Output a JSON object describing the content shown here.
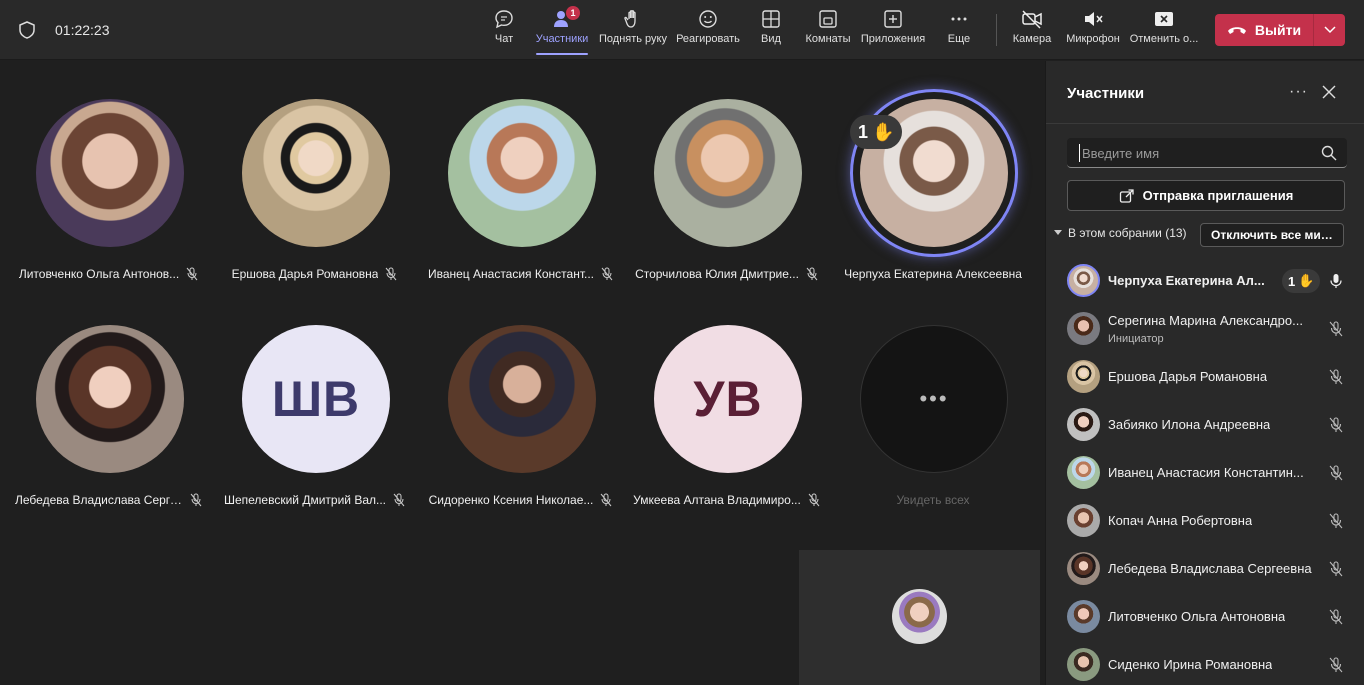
{
  "toolbar": {
    "timer": "01:22:23",
    "chat": "Чат",
    "participants": "Участники",
    "participants_badge": "1",
    "raise_hand": "Поднять руку",
    "react": "Реагировать",
    "view": "Вид",
    "rooms": "Комнаты",
    "apps": "Приложения",
    "more": "Еще",
    "camera": "Камера",
    "mic": "Микрофон",
    "share": "Отменить о...",
    "leave": "Выйти"
  },
  "stage": {
    "tiles": [
      {
        "name": "Литовченко Ольга Антонов..."
      },
      {
        "name": "Ершова Дарья Романовна"
      },
      {
        "name": "Иванец Анастасия Констант..."
      },
      {
        "name": "Сторчилова Юлия Дмитрие..."
      },
      {
        "name": "Черпуха Екатерина Алексеевна",
        "hand": "1"
      },
      {
        "name": "Лебедева Владислава Серге..."
      },
      {
        "name": "Шепелевский Дмитрий Вал...",
        "initials": "ШВ"
      },
      {
        "name": "Сидоренко Ксения Николае..."
      },
      {
        "name": "Умкеева Алтана Владимиро...",
        "initials": "УВ"
      }
    ],
    "more_dots": "•••",
    "see_all": "Увидеть всех"
  },
  "panel": {
    "title": "Участники",
    "more": "···",
    "search_placeholder": "Введите имя",
    "invite": "Отправка приглашения",
    "section": "В этом собрании (13)",
    "mute_all": "Отключить все мик...",
    "people": [
      {
        "name": "Черпуха Екатерина Ал...",
        "hand": "1"
      },
      {
        "name": "Серегина Марина Александро...",
        "role": "Инициатор"
      },
      {
        "name": "Ершова Дарья Романовна"
      },
      {
        "name": "Забияко Илона Андреевна"
      },
      {
        "name": "Иванец Анастасия Константин..."
      },
      {
        "name": "Копач Анна Робертовна"
      },
      {
        "name": "Лебедева Владислава Сергеевна"
      },
      {
        "name": "Литовченко Ольга Антоновна"
      },
      {
        "name": "Сиденко Ирина Романовна"
      }
    ]
  },
  "colors": {
    "accent": "#9ea2ff",
    "leave": "#c4314b",
    "initials_shv_bg": "#e8e6f5",
    "initials_shv_fg": "#3d3a6b",
    "initials_uv_bg": "#f1dde4",
    "initials_uv_fg": "#5a1f35"
  }
}
